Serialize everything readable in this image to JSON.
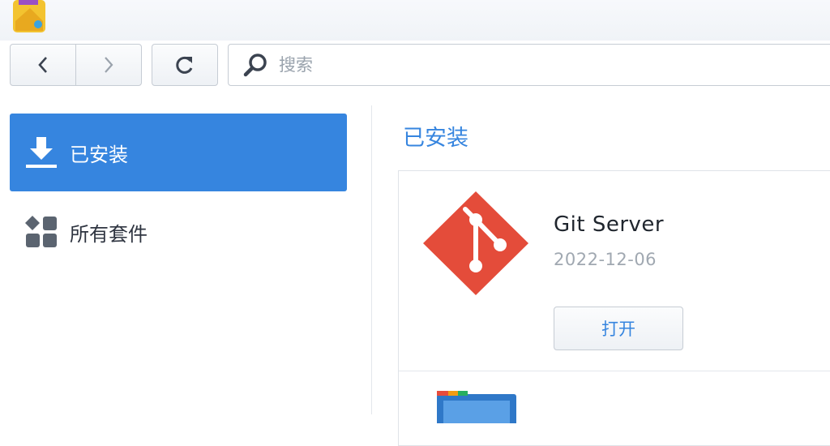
{
  "toolbar": {
    "back_icon": "chevron-left-icon",
    "forward_icon": "chevron-right-icon",
    "refresh_icon": "refresh-icon",
    "search_icon": "search-icon",
    "search_placeholder": "搜索"
  },
  "sidebar": {
    "items": [
      {
        "label": "已安装",
        "icon": "download-icon",
        "active": true
      },
      {
        "label": "所有套件",
        "icon": "grid-icon",
        "active": false
      }
    ]
  },
  "main": {
    "section_title": "已安装",
    "packages": [
      {
        "name": "Git Server",
        "date": "2022-12-06",
        "action_label": "打开",
        "icon": "git-icon"
      }
    ]
  },
  "colors": {
    "accent": "#3685df",
    "git_red": "#e44c3a"
  }
}
